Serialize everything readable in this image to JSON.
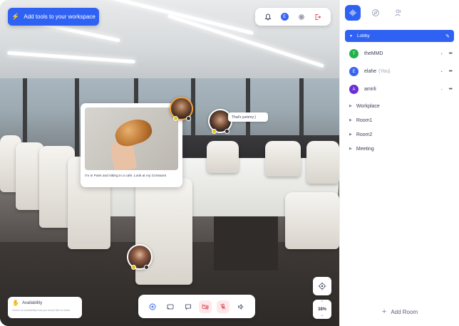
{
  "toolbar": {
    "add_tools_label": "Add tools to your workspace",
    "user_initial": "E"
  },
  "feed": {
    "post_caption": "I'm in Paris and sitting in a cafe. Look at my Croissant",
    "chat_message": "That's yummy:)"
  },
  "availability": {
    "title": "Availability",
    "hint": "Select an availability that you would like to share"
  },
  "zoom": {
    "level": "38%"
  },
  "panel": {
    "current_room": "Lobby",
    "members": [
      {
        "initial": "T",
        "name": "theMMD",
        "you": "",
        "color": "#22b14c",
        "status_color": "#b84fd6",
        "status_icon": "camera-icon"
      },
      {
        "initial": "E",
        "name": "elahe",
        "you": "(You)",
        "color": "#3a63f0",
        "status_color": "#e0404f",
        "status_icon": "mic-icon"
      },
      {
        "initial": "A",
        "name": "amirli",
        "you": "",
        "color": "#6a2fd4",
        "status_color": "#e3c21a",
        "status_icon": "chat-icon"
      }
    ],
    "rooms": [
      "Workplace",
      "Room1",
      "Room2",
      "Meeting"
    ],
    "add_room_label": "Add Room"
  },
  "colors": {
    "accent": "#2f62f2",
    "danger": "#e0404f"
  }
}
